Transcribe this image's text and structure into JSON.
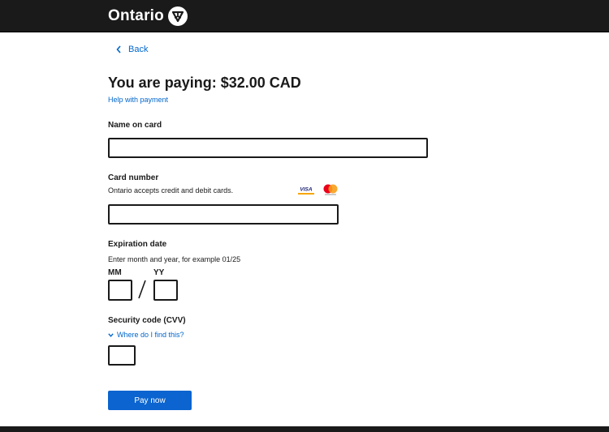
{
  "header": {
    "logo_text": "Ontario",
    "logo_icon": "ontario-trillium-icon"
  },
  "back": {
    "label": "Back",
    "icon": "chevron-left-icon"
  },
  "payment": {
    "title": "You are paying: $32.00 CAD",
    "help_link": "Help with payment"
  },
  "name_on_card": {
    "label": "Name on card",
    "value": ""
  },
  "card_number": {
    "label": "Card number",
    "hint": "Ontario accepts credit and debit cards.",
    "value": "",
    "card_logos": [
      "visa-icon",
      "mastercard-icon"
    ],
    "visa_text": "VISA"
  },
  "expiration": {
    "label": "Expiration date",
    "hint": "Enter month and year, for example 01/25",
    "month_label": "MM",
    "year_label": "YY",
    "month_value": "",
    "year_value": ""
  },
  "security_code": {
    "label": "Security code (CVV)",
    "help_toggle": "Where do I find this?",
    "toggle_icon": "chevron-down-icon",
    "value": ""
  },
  "actions": {
    "pay_label": "Pay now"
  },
  "colors": {
    "header_bg": "#1a1a1a",
    "link": "#0066cc",
    "primary_button": "#0b64cf"
  }
}
